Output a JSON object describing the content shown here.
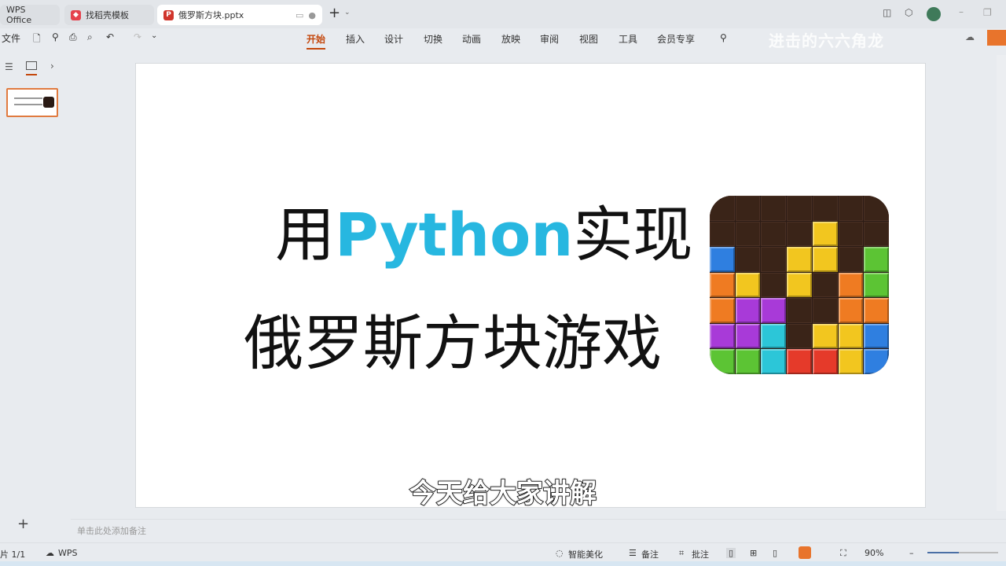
{
  "tabs": [
    {
      "label": "WPS Office"
    },
    {
      "label": "找稻壳模板"
    },
    {
      "label": "俄罗斯方块.pptx"
    }
  ],
  "toolbar": {
    "file": "文件"
  },
  "menu": [
    "开始",
    "插入",
    "设计",
    "切换",
    "动画",
    "放映",
    "审阅",
    "视图",
    "工具",
    "会员专享"
  ],
  "watermark": "进击的六六角龙",
  "slide": {
    "line1_pre": "用",
    "line1_python": "Python",
    "line1_post": "实现",
    "line2": "俄罗斯方块游戏",
    "python_color": "#27b7e0"
  },
  "subtitle": "今天给大家讲解",
  "notes_placeholder": "单击此处添加备注",
  "status": {
    "slide_count": "片 1/1",
    "wps": "WPS",
    "beautify": "智能美化",
    "notes": "备注",
    "comments": "批注",
    "zoom": "90%"
  },
  "accent": "#c4470c"
}
